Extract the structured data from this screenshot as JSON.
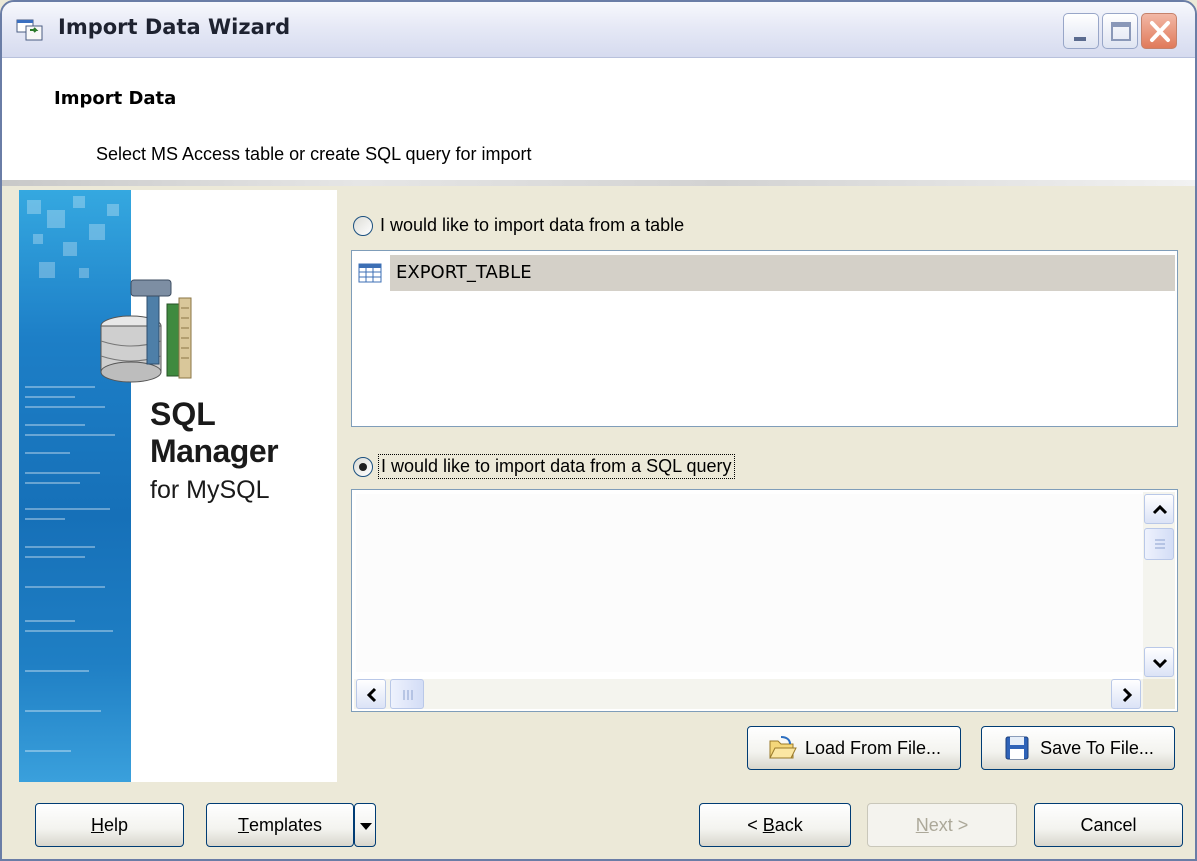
{
  "window": {
    "title": "Import Data Wizard",
    "controls": {
      "minimize": "minimize",
      "maximize": "maximize",
      "close": "close"
    }
  },
  "header": {
    "title": "Import Data",
    "subtitle": "Select MS Access table or create SQL query for import"
  },
  "banner": {
    "line1": "SQL",
    "line2": "Manager",
    "line3": "for MySQL"
  },
  "options": {
    "table_option": {
      "label": "I would like to import data from a table",
      "checked": false
    },
    "query_option": {
      "label": "I would like to import data from a SQL query",
      "checked": true
    }
  },
  "tables": [
    {
      "name": "EXPORT_TABLE",
      "selected": true,
      "icon": "table-grid-icon"
    }
  ],
  "sql_editor": {
    "value": ""
  },
  "file_buttons": {
    "load": "Load From File...",
    "save": "Save To File..."
  },
  "footer": {
    "help": {
      "hotkey": "H",
      "rest": "elp"
    },
    "templates": {
      "hotkey": "T",
      "rest": "emplates"
    },
    "back": {
      "prefix": "< ",
      "hotkey": "B",
      "rest": "ack"
    },
    "next": {
      "hotkey": "N",
      "rest": "ext >",
      "disabled": true
    },
    "cancel": "Cancel"
  },
  "colors": {
    "selection_bg": "#d4d0c8",
    "border": "#7f9db9",
    "button_border": "#003c74",
    "banner_blue": "#1d7fc7"
  }
}
